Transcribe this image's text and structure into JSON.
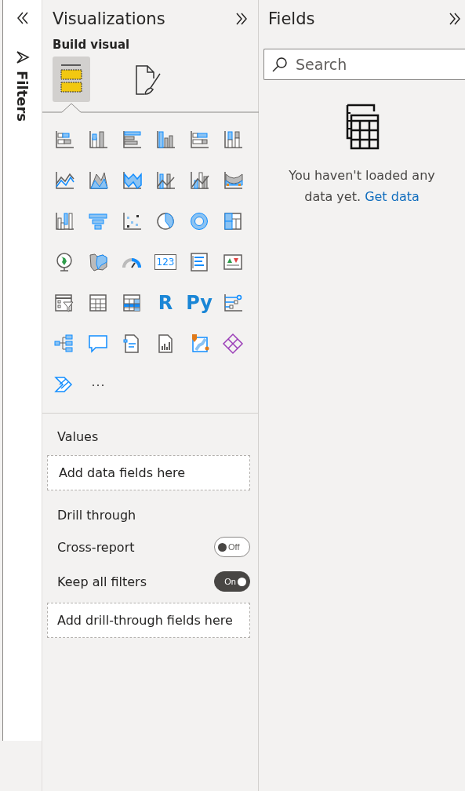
{
  "filters_pane": {
    "title": "Filters"
  },
  "visualizations": {
    "title": "Visualizations",
    "section_label": "Build visual",
    "pane_tabs": [
      {
        "kind": "fields",
        "selected": true
      },
      {
        "kind": "format",
        "selected": false
      }
    ],
    "gallery": [
      {
        "kind": "stacked-bar"
      },
      {
        "kind": "stacked-column"
      },
      {
        "kind": "clustered-bar"
      },
      {
        "kind": "clustered-column"
      },
      {
        "kind": "bar-100"
      },
      {
        "kind": "column-100"
      },
      {
        "kind": "line"
      },
      {
        "kind": "area"
      },
      {
        "kind": "stacked-area"
      },
      {
        "kind": "line-column"
      },
      {
        "kind": "line-column-2"
      },
      {
        "kind": "ribbon"
      },
      {
        "kind": "waterfall"
      },
      {
        "kind": "funnel"
      },
      {
        "kind": "scatter"
      },
      {
        "kind": "pie"
      },
      {
        "kind": "donut"
      },
      {
        "kind": "treemap"
      },
      {
        "kind": "globe"
      },
      {
        "kind": "filled-map"
      },
      {
        "kind": "gauge"
      },
      {
        "kind": "card",
        "label": "123"
      },
      {
        "kind": "multirow-card"
      },
      {
        "kind": "kpi"
      },
      {
        "kind": "slicer"
      },
      {
        "kind": "table"
      },
      {
        "kind": "matrix"
      },
      {
        "kind": "letters",
        "label": "R"
      },
      {
        "kind": "letters",
        "label": "Py"
      },
      {
        "kind": "influencers"
      },
      {
        "kind": "tree"
      },
      {
        "kind": "speech"
      },
      {
        "kind": "narrative"
      },
      {
        "kind": "report"
      },
      {
        "kind": "azure-map"
      },
      {
        "kind": "diamond"
      },
      {
        "kind": "chevron"
      },
      {
        "kind": "more",
        "label": "···"
      }
    ],
    "values": {
      "label": "Values",
      "placeholder": "Add data fields here"
    },
    "drill_through": {
      "label": "Drill through",
      "toggles": [
        {
          "label": "Cross-report",
          "on": false,
          "state_label": "Off"
        },
        {
          "label": "Keep all filters",
          "on": true,
          "state_label": "On"
        }
      ],
      "placeholder": "Add drill-through fields here"
    }
  },
  "fields": {
    "title": "Fields",
    "search": {
      "placeholder": "Search"
    },
    "empty_message": "You haven't loaded any data yet.",
    "link": "Get data"
  }
}
